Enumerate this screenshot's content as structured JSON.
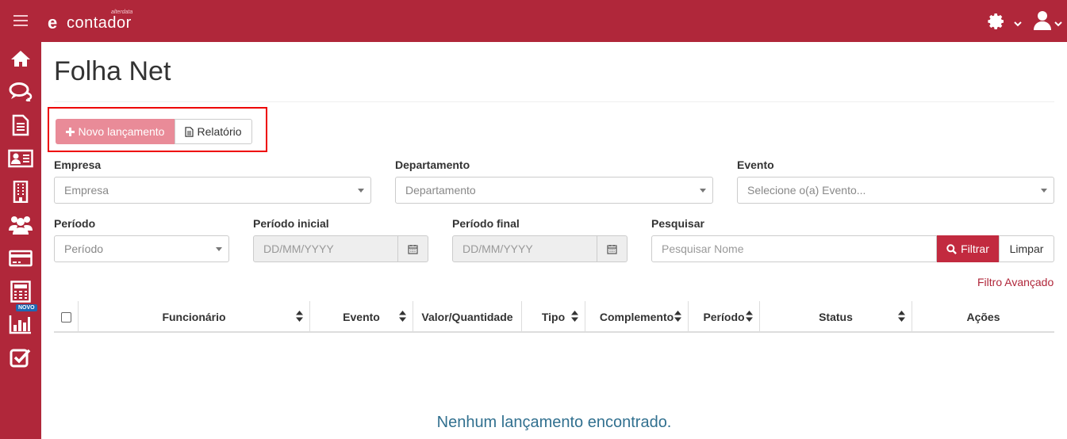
{
  "app": {
    "logo_letter": "e",
    "logo_name": "contador",
    "logo_sub": "alterdata"
  },
  "sidebar": {
    "badge_label": "NOVO"
  },
  "page": {
    "title": "Folha Net"
  },
  "actions": {
    "new_label": "Novo lançamento",
    "report_label": "Relatório"
  },
  "filters": {
    "empresa": {
      "label": "Empresa",
      "value": "Empresa"
    },
    "departamento": {
      "label": "Departamento",
      "value": "Departamento"
    },
    "evento": {
      "label": "Evento",
      "value": "Selecione o(a) Evento..."
    },
    "periodo": {
      "label": "Período",
      "value": "Período"
    },
    "periodo_inicial": {
      "label": "Período inicial",
      "placeholder": "DD/MM/YYYY"
    },
    "periodo_final": {
      "label": "Período final",
      "placeholder": "DD/MM/YYYY"
    },
    "pesquisar": {
      "label": "Pesquisar",
      "placeholder": "Pesquisar Nome"
    },
    "filter_label": "Filtrar",
    "clear_label": "Limpar",
    "advanced_label": "Filtro Avançado"
  },
  "table": {
    "columns": [
      "Funcionário",
      "Evento",
      "Valor/Quantidade",
      "Tipo",
      "Complemento",
      "Período",
      "Status",
      "Ações"
    ]
  },
  "empty_message": "Nenhum lançamento encontrado.",
  "colors": {
    "brand": "#b0273a",
    "primary_light": "#e98b98",
    "filter_button": "#c22a3f",
    "empty_text": "#31708f",
    "badge": "#1f68b3"
  }
}
